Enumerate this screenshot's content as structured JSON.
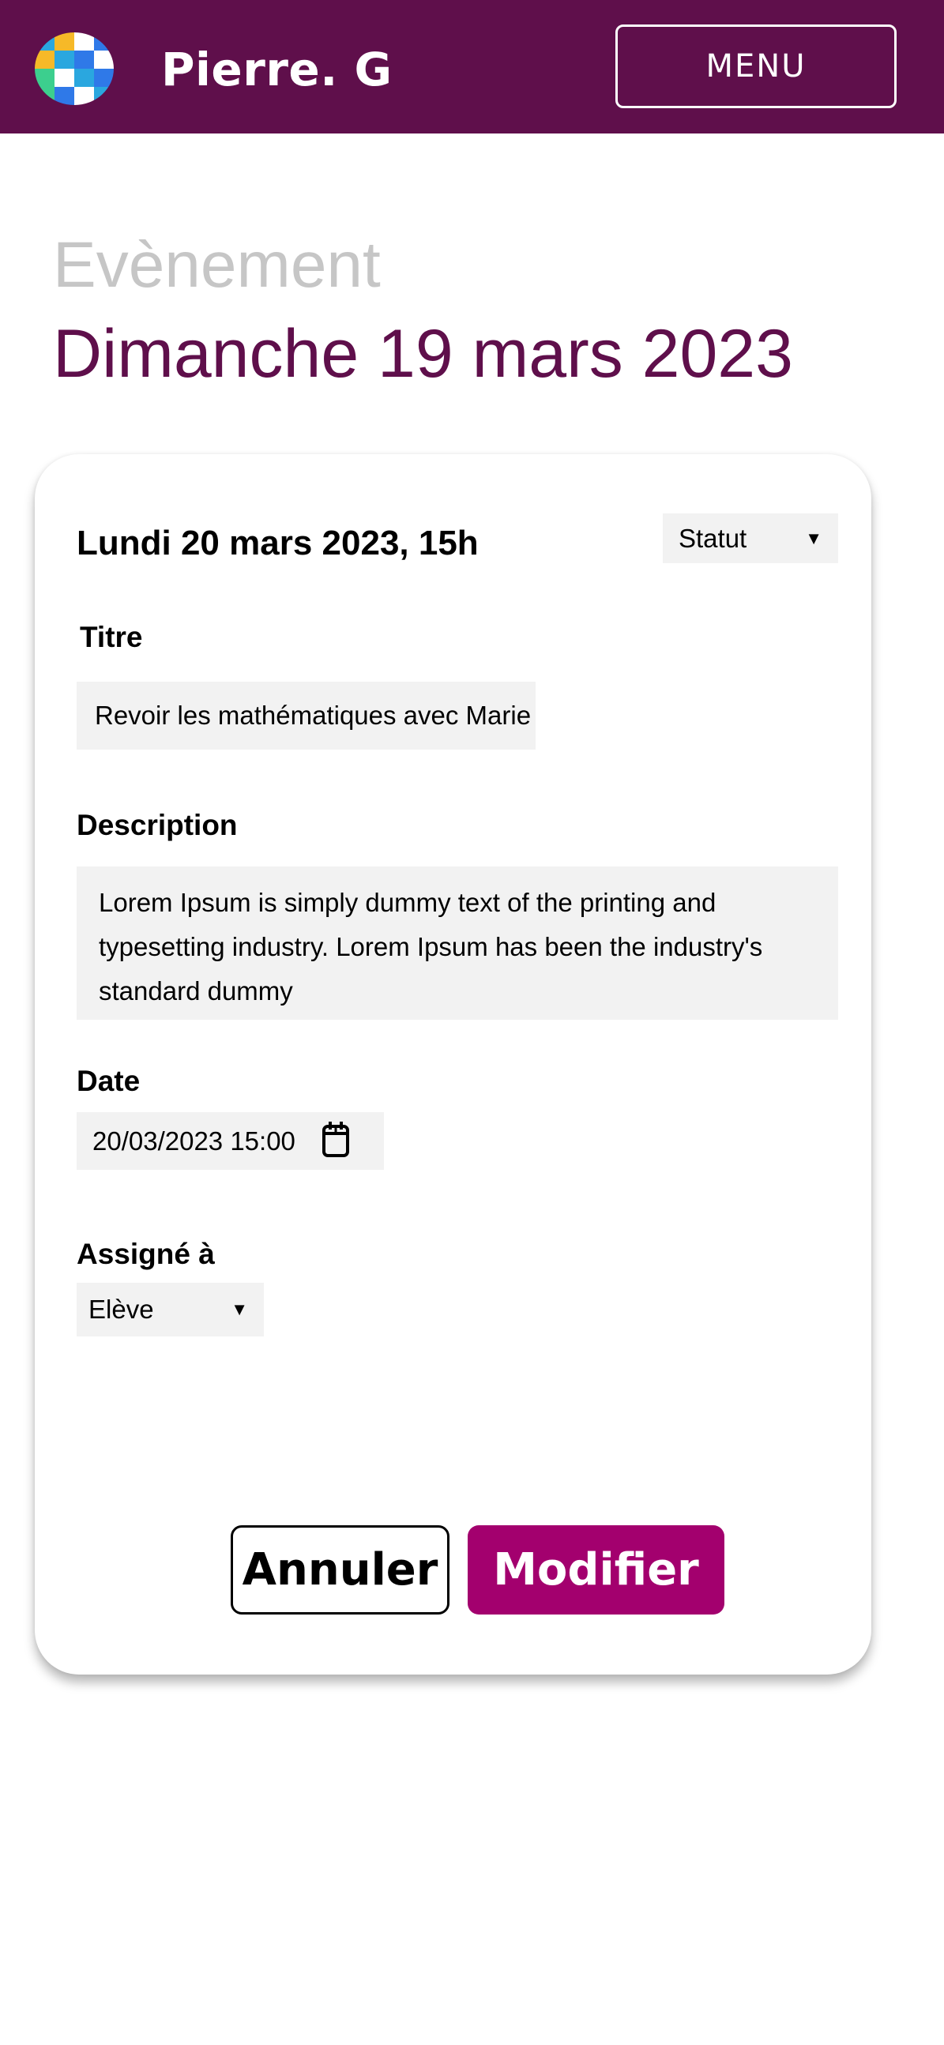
{
  "header": {
    "user_name": "Pierre. G",
    "menu_label": "MENU",
    "logo_colors": [
      "#2aa7df",
      "#f6b928",
      "#ffffff",
      "#2f79e8",
      "#f6b928",
      "#2aa7df",
      "#2f79e8",
      "#ffffff",
      "#3ccf8e",
      "#ffffff",
      "#2aa7df",
      "#2f79e8",
      "#3ccf8e",
      "#2f79e8",
      "#ffffff",
      "#2aa7df"
    ]
  },
  "page": {
    "section_label": "Evènement",
    "date_heading": "Dimanche 19 mars 2023"
  },
  "event": {
    "datetime_heading": "Lundi 20 mars 2023, 15h",
    "status_value": "Statut",
    "title_label": "Titre",
    "title_value": "Revoir les mathématiques avec Marie",
    "description_label": "Description",
    "description_value": "Lorem Ipsum is simply dummy text of the printing and typesetting industry. Lorem Ipsum has been the industry's standard dummy",
    "date_label": "Date",
    "date_value": "20/03/2023 15:00",
    "assigned_label": "Assigné à",
    "assigned_value": "Elève"
  },
  "actions": {
    "cancel_label": "Annuler",
    "save_label": "Modifier"
  },
  "colors": {
    "header_bg": "#5f0f4b",
    "accent": "#a3006e",
    "field_bg": "#f2f2f2"
  },
  "icons": {
    "calendar": "calendar-icon",
    "dropdown": "triangle-down-icon"
  }
}
